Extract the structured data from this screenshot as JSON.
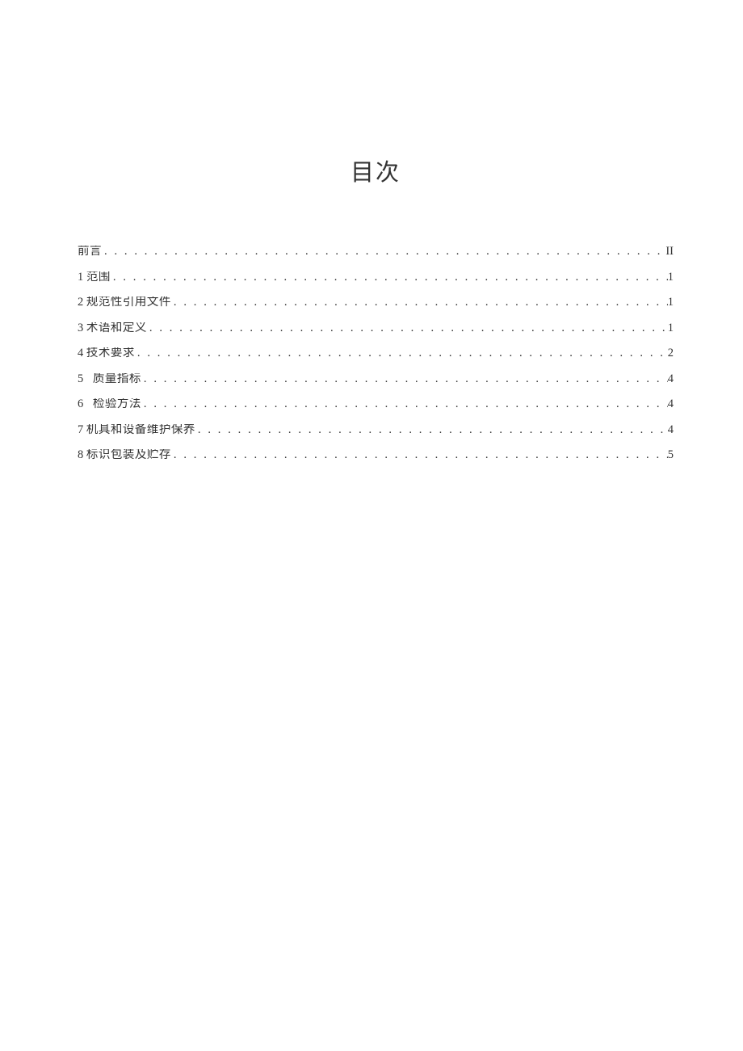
{
  "title": "目次",
  "entries": [
    {
      "num": "",
      "text": "前言",
      "page": "II"
    },
    {
      "num": "1",
      "text": "范围",
      "page": "1"
    },
    {
      "num": "2",
      "text": "规范性引用文件",
      "page": "1"
    },
    {
      "num": "3",
      "text": "术语和定义",
      "page": "1"
    },
    {
      "num": "4",
      "text": "技术要求",
      "page": "2"
    },
    {
      "num": "5",
      "text": "质量指标",
      "gap": true,
      "page": "4"
    },
    {
      "num": "6",
      "text": "检验方法",
      "gap": true,
      "page": "4"
    },
    {
      "num": "7",
      "text": "机具和设备维护保养",
      "page": "4"
    },
    {
      "num": "8",
      "text": "标识包装及贮存",
      "page": "5"
    }
  ],
  "dots": ". . . . . . . . . . . . . . . . . . . . . . . . . . . . . . . . . . . . . . . . . . . . . . . . . . . . . . . . . . . . . . . . . . . . . . . . . . . . . . . . . . . . . . . . . . . . . . . . . . . . . . . . . . . . . . . . . . . . . . . . . . . . . . . . . . . . . . . . . . . . . . . . ."
}
